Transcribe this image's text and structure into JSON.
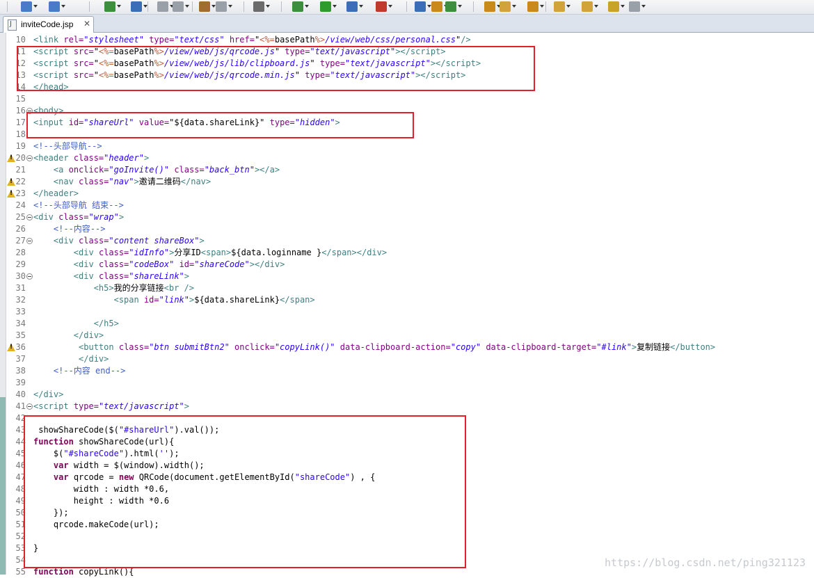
{
  "editor_tab": {
    "label": "inviteCode.jsp",
    "close": "✕"
  },
  "watermark": "https://blog.csdn.net/ping321123",
  "lines": [
    {
      "n": "10",
      "html": "<span class=\"t\">&lt;link</span> <span class=\"a\">rel=</span><span class=\"s\">\"stylesheet\"</span> <span class=\"a\">type=</span><span class=\"s\">\"text/css\"</span> <span class=\"a\">href=</span>\"<span class=\"e\">&lt;%=</span>basePath<span class=\"e\">%&gt;</span><span class=\"s\">/view/web/css/personal.css</span>\"<span class=\"t\">/&gt;</span>"
    },
    {
      "n": "11",
      "html": "<span class=\"t\">&lt;script</span> <span class=\"a\">src=</span>\"<span class=\"e\">&lt;%=</span>basePath<span class=\"e\">%&gt;</span><span class=\"s\">/view/web/js/qrcode.js</span>\" <span class=\"a\">type=</span><span class=\"s\">\"text/javascript\"</span><span class=\"t\">&gt;&lt;/script&gt;</span>"
    },
    {
      "n": "12",
      "html": "<span class=\"t\">&lt;script</span> <span class=\"a\">src=</span>\"<span class=\"e\">&lt;%=</span>basePath<span class=\"e\">%&gt;</span><span class=\"s\">/view/web/js/lib/clipboard.js</span>\" <span class=\"a\">type=</span><span class=\"s\">\"text/javascript\"</span><span class=\"t\">&gt;&lt;/script&gt;</span>"
    },
    {
      "n": "13",
      "html": "<span class=\"t\">&lt;script</span> <span class=\"a\">src=</span>\"<span class=\"e\">&lt;%=</span>basePath<span class=\"e\">%&gt;</span><span class=\"s\">/view/web/js/qrcode.min.js</span>\" <span class=\"a\">type=</span><span class=\"s\">\"text/javascript\"</span><span class=\"t\">&gt;&lt;/script&gt;</span>"
    },
    {
      "n": "14",
      "html": "<span class=\"t\">&lt;/head&gt;</span>"
    },
    {
      "n": "15",
      "html": ""
    },
    {
      "n": "16",
      "fold": true,
      "html": "<span class=\"t\">&lt;body&gt;</span>"
    },
    {
      "n": "17",
      "html": "<span class=\"t\">&lt;input</span> <span class=\"a\">id=</span><span class=\"s\">\"shareUrl\"</span> <span class=\"a\">value=</span>\"${data.shareLink}\" <span class=\"a\">type=</span><span class=\"s\">\"hidden\"</span><span class=\"t\">&gt;</span>"
    },
    {
      "n": "18",
      "html": ""
    },
    {
      "n": "19",
      "html": "<span class=\"c\">&lt;!--头部导航--&gt;</span>"
    },
    {
      "n": "20",
      "warn": true,
      "fold": true,
      "html": "<span class=\"t\">&lt;header</span> <span class=\"a\">class=</span><span class=\"s\">\"header\"</span><span class=\"t\">&gt;</span>"
    },
    {
      "n": "21",
      "html": "    <span class=\"t\">&lt;a</span> <span class=\"a\">onclick=</span><span class=\"s\">\"goInvite()\"</span> <span class=\"a\">class=</span><span class=\"s\">\"back_btn\"</span><span class=\"t\">&gt;&lt;/a&gt;</span>"
    },
    {
      "n": "22",
      "warn": true,
      "html": "    <span class=\"t\">&lt;nav</span> <span class=\"a\">class=</span><span class=\"s\">\"nav\"</span><span class=\"t\">&gt;</span>邀请二维码<span class=\"t\">&lt;/nav&gt;</span>"
    },
    {
      "n": "23",
      "warn": true,
      "html": "<span class=\"t\">&lt;/header&gt;</span>"
    },
    {
      "n": "24",
      "html": "<span class=\"c\">&lt;!--头部导航 结束--&gt;</span>"
    },
    {
      "n": "25",
      "fold": true,
      "html": "<span class=\"t\">&lt;div</span> <span class=\"a\">class=</span><span class=\"s\">\"wrap\"</span><span class=\"t\">&gt;</span>"
    },
    {
      "n": "26",
      "html": "    <span class=\"c\">&lt;!--内容--&gt;</span>"
    },
    {
      "n": "27",
      "fold": true,
      "html": "    <span class=\"t\">&lt;div</span> <span class=\"a\">class=</span><span class=\"s\">\"content shareBox\"</span><span class=\"t\">&gt;</span>"
    },
    {
      "n": "28",
      "html": "        <span class=\"t\">&lt;div</span> <span class=\"a\">class=</span><span class=\"s\">\"idInfo\"</span><span class=\"t\">&gt;</span>分享ID<span class=\"t\">&lt;span&gt;</span>${data.loginname }<span class=\"t\">&lt;/span&gt;&lt;/div&gt;</span>"
    },
    {
      "n": "29",
      "html": "        <span class=\"t\">&lt;div</span> <span class=\"a\">class=</span><span class=\"s\">\"codeBox\"</span> <span class=\"a\">id=</span><span class=\"s\">\"shareCode\"</span><span class=\"t\">&gt;&lt;/div&gt;</span>"
    },
    {
      "n": "30",
      "fold": true,
      "html": "        <span class=\"t\">&lt;div</span> <span class=\"a\">class=</span><span class=\"s\">\"shareLink\"</span><span class=\"t\">&gt;</span>"
    },
    {
      "n": "31",
      "html": "            <span class=\"t\">&lt;h5&gt;</span>我的分享链接<span class=\"t\">&lt;br /&gt;</span>"
    },
    {
      "n": "32",
      "html": "                <span class=\"t\">&lt;span</span> <span class=\"a\">id=</span><span class=\"s\">\"link\"</span><span class=\"t\">&gt;</span>${data.shareLink}<span class=\"t\">&lt;/span&gt;</span>"
    },
    {
      "n": "33",
      "html": ""
    },
    {
      "n": "34",
      "html": "            <span class=\"t\">&lt;/h5&gt;</span>"
    },
    {
      "n": "35",
      "html": "        <span class=\"t\">&lt;/div&gt;</span>"
    },
    {
      "n": "36",
      "warn": true,
      "html": "         <span class=\"t\">&lt;button</span> <span class=\"a\">class=</span><span class=\"s\">\"btn submitBtn2\"</span> <span class=\"a\">onclick=</span><span class=\"s\">\"copyLink()\"</span> <span class=\"a\">data-clipboard-action=</span><span class=\"s\">\"copy\"</span> <span class=\"a\">data-clipboard-target=</span><span class=\"s\">\"#link\"</span><span class=\"t\">&gt;</span>复制链接<span class=\"t\">&lt;/button&gt;</span>"
    },
    {
      "n": "37",
      "html": "         <span class=\"t\">&lt;/div&gt;</span>"
    },
    {
      "n": "38",
      "html": "    <span class=\"c\">&lt;!--内容 end--&gt;</span>"
    },
    {
      "n": "39",
      "html": ""
    },
    {
      "n": "40",
      "html": "<span class=\"t\">&lt;/div&gt;</span>"
    },
    {
      "n": "41",
      "fold": true,
      "html": "<span class=\"t\">&lt;script</span> <span class=\"a\">type=</span><span class=\"s\">\"text/javascript\"</span><span class=\"t\">&gt;</span>"
    },
    {
      "n": "42",
      "html": ""
    },
    {
      "n": "43",
      "html": " showShareCode($(<span class=\"j\">\"#shareUrl\"</span>).val());"
    },
    {
      "n": "44",
      "html": "<span class=\"k\">function</span> showShareCode(url){"
    },
    {
      "n": "45",
      "html": "    $(<span class=\"j\">\"#shareCode\"</span>).html(<span class=\"j\">''</span>);"
    },
    {
      "n": "46",
      "html": "    <span class=\"k\">var</span> width = $(window).width();"
    },
    {
      "n": "47",
      "html": "    <span class=\"k\">var</span> qrcode = <span class=\"k\">new</span> QRCode(document.getElementById(<span class=\"j\">\"shareCode\"</span>) , {"
    },
    {
      "n": "48",
      "html": "        width : width *0.6,"
    },
    {
      "n": "49",
      "html": "        height : width *0.6"
    },
    {
      "n": "50",
      "html": "    });"
    },
    {
      "n": "51",
      "html": "    qrcode.makeCode(url);"
    },
    {
      "n": "52",
      "html": ""
    },
    {
      "n": "53",
      "html": "}"
    },
    {
      "n": "54",
      "html": ""
    },
    {
      "n": "55",
      "html": "<span class=\"k\">function</span> copyLink(){"
    }
  ]
}
